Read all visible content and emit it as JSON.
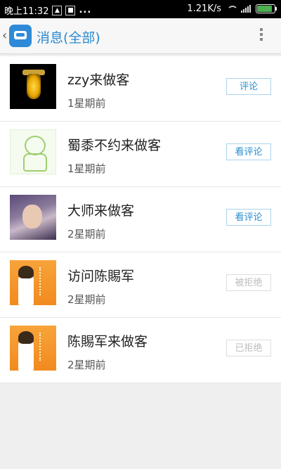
{
  "status_bar": {
    "time": "晚上11:32",
    "notification_icons": [
      "alarm-icon",
      "image-icon"
    ],
    "more_notifications": "...",
    "speed": "1.21K/s",
    "battery_level": 0.8
  },
  "header": {
    "title": "消息(全部)"
  },
  "messages": [
    {
      "avatar": "lamp-avatar",
      "name": "zzy来做客",
      "time": "1星期前",
      "action": "评论",
      "action_enabled": true
    },
    {
      "avatar": "cartoon-avatar",
      "name": "蜀黍不约来做客",
      "time": "1星期前",
      "action": "看评论",
      "action_enabled": true
    },
    {
      "avatar": "photo-avatar",
      "name": "大师来做客",
      "time": "2星期前",
      "action": "看评论",
      "action_enabled": true
    },
    {
      "avatar": "orange-portrait-avatar",
      "name": "访问陈賜军",
      "time": "2星期前",
      "action": "被拒绝",
      "action_enabled": false
    },
    {
      "avatar": "orange-portrait-avatar",
      "name": "陈賜军来做客",
      "time": "2星期前",
      "action": "已拒绝",
      "action_enabled": false
    }
  ],
  "colors": {
    "accent": "#2b8ad0",
    "button_border": "#a9d4ec",
    "disabled_text": "#bdbdbd",
    "background": "#efefef"
  }
}
